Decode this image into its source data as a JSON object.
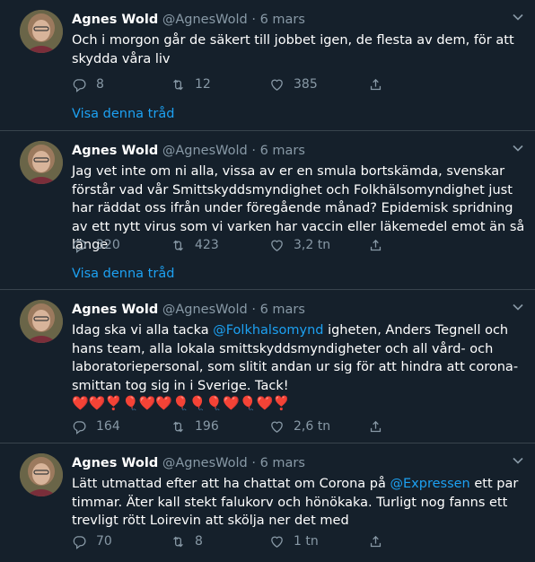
{
  "tweets": [
    {
      "name": "Agnes Wold",
      "handle": "@AgnesWold",
      "dot": "·",
      "date": "6 mars",
      "text": "Och i morgon går de säkert till jobbet igen, de flesta av dem, för att skydda våra liv",
      "replies": "8",
      "retweets": "12",
      "likes": "385",
      "thread_link": "Visa denna tråd"
    },
    {
      "name": "Agnes Wold",
      "handle": "@AgnesWold",
      "dot": "·",
      "date": "6 mars",
      "text": "Jag vet inte om ni alla, vissa av er en smula bortskämda, svenskar förstår vad vår Smittskyddsmyndighet och Folkhälsomyndighet just har räddat oss ifrån under föregående månad? Epidemisk spridning av ett nytt virus som vi varken har vaccin eller läkemedel emot än så länge",
      "replies": "320",
      "retweets": "423",
      "likes": "3,2 tn",
      "thread_link": "Visa denna tråd"
    },
    {
      "name": "Agnes Wold",
      "handle": "@AgnesWold",
      "dot": "·",
      "date": "6 mars",
      "text_before": "Idag ska vi alla tacka ",
      "mention": "@Folkhalsomynd",
      "text_after": " igheten, Anders Tegnell och hans team, alla lokala smittskyddsmyndigheter och all vård- och laboratoriepersonal, som slitit andan ur sig för att hindra att corona-smittan tog sig in i Sverige. Tack!",
      "emojis": "❤️❤️❣️🎈❤️❤️🎈🎈🎈❤️🎈❤️❣️",
      "replies": "164",
      "retweets": "196",
      "likes": "2,6 tn"
    },
    {
      "name": "Agnes Wold",
      "handle": "@AgnesWold",
      "dot": "·",
      "date": "6 mars",
      "text_before": "Lätt utmattad efter att ha chattat om Corona på ",
      "mention": "@Expressen",
      "text_after": " ett par timmar. Äter kall stekt falukorv och hönökaka. Turligt nog fanns ett trevligt rött Loirevin att skölja ner det med",
      "replies": "70",
      "retweets": "8",
      "likes": "1 tn"
    }
  ],
  "icons": {
    "reply": "reply-icon",
    "retweet": "retweet-icon",
    "like": "heart-icon",
    "share": "share-icon",
    "caret": "chevron-down-icon"
  },
  "colors": {
    "background": "#15202b",
    "divider": "#38444d",
    "muted": "#8899a6",
    "link": "#1da1f2"
  }
}
